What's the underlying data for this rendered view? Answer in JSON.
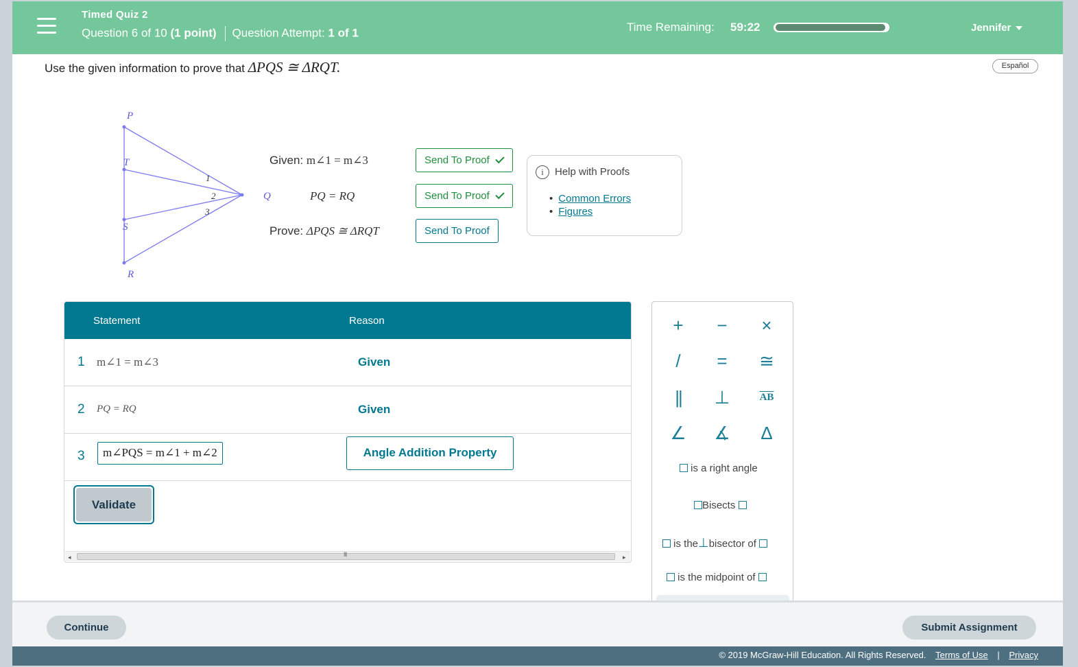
{
  "header": {
    "quiz_title": "Timed Quiz 2",
    "question_position": "Question 6 of 10",
    "points": "(1 point)",
    "attempt_label": "Question Attempt:",
    "attempt_value": "1 of 1",
    "time_label": "Time Remaining:",
    "time_value": "59:22",
    "time_progress_fraction": 0.98,
    "user_name": "Jennifer"
  },
  "prompt": {
    "text": "Use the given information to prove that",
    "math": "ΔPQS ≅ ΔRQT."
  },
  "language_button": "Español",
  "figure": {
    "points": {
      "P": "P",
      "T": "T",
      "S": "S",
      "R": "R",
      "Q": "Q"
    },
    "angles": [
      "1",
      "2",
      "3"
    ]
  },
  "given": {
    "given_label": "Given:",
    "given1": "m∠1 = m∠3",
    "given2": "PQ = RQ",
    "prove_label": "Prove:",
    "prove": "ΔPQS ≅ ΔRQT",
    "send_label": "Send To Proof"
  },
  "help": {
    "title": "Help with Proofs",
    "links": [
      "Common Errors",
      "Figures"
    ]
  },
  "proof_table": {
    "headers": [
      "Statement",
      "Reason"
    ],
    "rows": [
      {
        "num": "1",
        "statement": "m∠1 = m∠3",
        "reason": "Given"
      },
      {
        "num": "2",
        "statement": "PQ = RQ",
        "reason": "Given"
      },
      {
        "num": "3",
        "statement": "m∠PQS = m∠1 + m∠2",
        "reason": "Angle Addition Property"
      }
    ],
    "validate_label": "Validate"
  },
  "palette": {
    "symbols": [
      "+",
      "−",
      "×",
      "/",
      "=",
      "≅",
      "||",
      "⊥",
      "AB",
      "∠",
      "∡",
      "Δ"
    ],
    "right_angle": "is a right angle",
    "bisects": "Bisects",
    "perp_bisector_pre": "is the",
    "perp_bisector_post": "bisector of",
    "midpoint": "is the midpoint of"
  },
  "footer": {
    "continue_label": "Continue",
    "submit_label": "Submit Assignment",
    "copyright": "© 2019 McGraw-Hill Education. All Rights Reserved.",
    "terms": "Terms of Use",
    "privacy": "Privacy"
  },
  "colors": {
    "header_bg": "#74c79a",
    "accent": "#00788f",
    "send_green": "#1f8f3e",
    "figure_line": "#7b7bef"
  }
}
